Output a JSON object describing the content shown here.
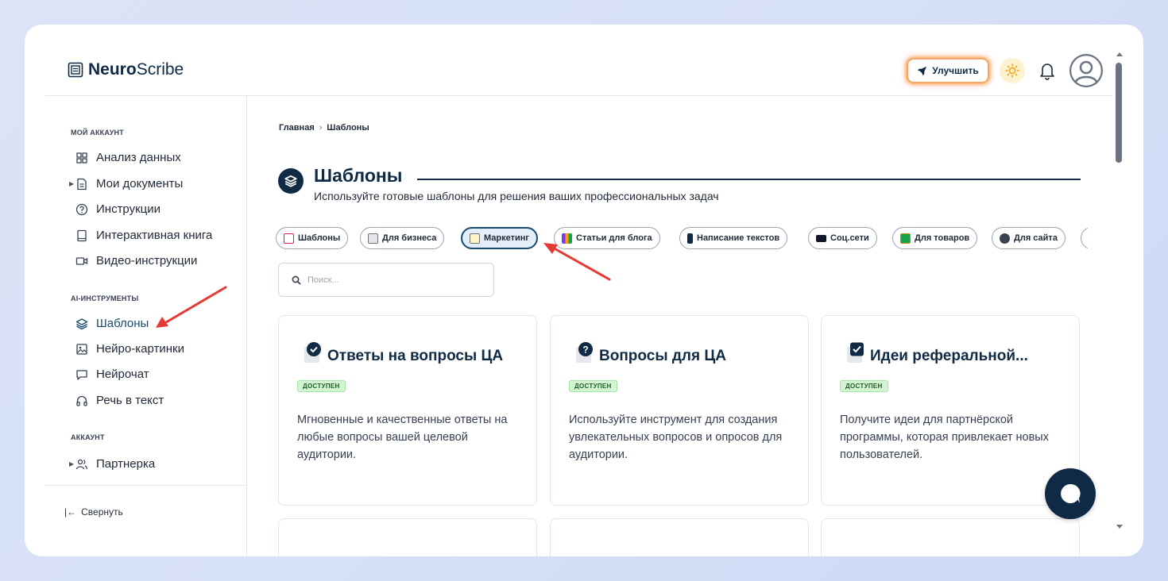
{
  "app": {
    "logo_bold": "Neuro",
    "logo_rest": "Scribe"
  },
  "header": {
    "upgrade_label": "Улучшить"
  },
  "sidebar": {
    "section_account": "МОЙ АККАУНТ",
    "items_account": [
      {
        "label": "Анализ данных",
        "icon": "grid-icon"
      },
      {
        "label": "Мои документы",
        "icon": "document-icon"
      },
      {
        "label": "Инструкции",
        "icon": "question-icon"
      },
      {
        "label": "Интерактивная книга",
        "icon": "book-icon"
      },
      {
        "label": "Видео-инструкции",
        "icon": "video-icon"
      }
    ],
    "section_ai": "AI-ИНСТРУМЕНТЫ",
    "items_ai": [
      {
        "label": "Шаблоны",
        "icon": "layers-icon"
      },
      {
        "label": "Нейро-картинки",
        "icon": "image-icon"
      },
      {
        "label": "Нейрочат",
        "icon": "chat-icon"
      },
      {
        "label": "Речь в текст",
        "icon": "headphones-icon"
      }
    ],
    "section_acc2": "АККАУНТ",
    "items_acc2": [
      {
        "label": "Партнерка",
        "icon": "users-icon"
      }
    ],
    "collapse_label": "Свернуть"
  },
  "breadcrumb": {
    "home": "Главная",
    "sep": "›",
    "current": "Шаблоны"
  },
  "page": {
    "title": "Шаблоны",
    "subtitle": "Используйте готовые шаблоны для решения ваших профессиональных задач"
  },
  "chips": [
    {
      "label": "Шаблоны",
      "color": "#e11d48"
    },
    {
      "label": "Для бизнеса",
      "color": "#6b7280"
    },
    {
      "label": "Маркетинг",
      "color": "#6b7280",
      "active": true
    },
    {
      "label": "Статьи для блога",
      "color": "#7c3aed"
    },
    {
      "label": "Написание текстов",
      "color": "#0f2a44"
    },
    {
      "label": "Соц.сети",
      "color": "#111827"
    },
    {
      "label": "Для товаров",
      "color": "#16a34a"
    },
    {
      "label": "Для сайта",
      "color": "#374151"
    }
  ],
  "search": {
    "placeholder": "Поиск..."
  },
  "cards": [
    {
      "title": "Ответы на вопросы ЦА",
      "badge": "ДОСТУПЕН",
      "desc": "Мгновенные и качественные ответы на любые вопросы вашей целевой аудитории.",
      "icon": "check-circle-icon"
    },
    {
      "title": "Вопросы для ЦА",
      "badge": "ДОСТУПЕН",
      "desc": "Используйте инструмент для создания увлекательных вопросов и опросов для аудитории.",
      "icon": "question-circle-icon"
    },
    {
      "title": "Идеи реферальной...",
      "badge": "ДОСТУПЕН",
      "desc": "Получите идеи для партнёрской программы, которая привлекает новых пользователей.",
      "icon": "checkbox-icon"
    }
  ],
  "colors": {
    "accent": "#0f2a44",
    "badge_bg": "#d4f5d4",
    "annotation_arrow": "#e53935"
  }
}
